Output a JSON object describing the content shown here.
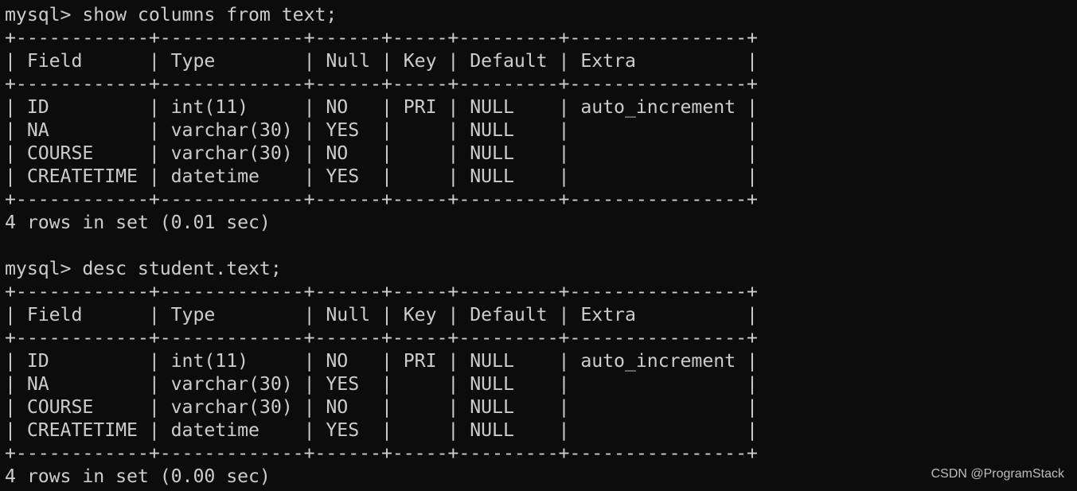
{
  "terminal": {
    "prompt": "mysql> ",
    "blocks": [
      {
        "command": "show columns from text;",
        "columns": [
          "Field",
          "Type",
          "Null",
          "Key",
          "Default",
          "Extra"
        ],
        "rows": [
          [
            "ID",
            "int(11)",
            "NO",
            "PRI",
            "NULL",
            "auto_increment"
          ],
          [
            "NA",
            "varchar(30)",
            "YES",
            "",
            "NULL",
            ""
          ],
          [
            "COURSE",
            "varchar(30)",
            "NO",
            "",
            "NULL",
            ""
          ],
          [
            "CREATETIME",
            "datetime",
            "YES",
            "",
            "NULL",
            ""
          ]
        ],
        "footer": "4 rows in set (0.01 sec)"
      },
      {
        "command": "desc student.text;",
        "columns": [
          "Field",
          "Type",
          "Null",
          "Key",
          "Default",
          "Extra"
        ],
        "rows": [
          [
            "ID",
            "int(11)",
            "NO",
            "PRI",
            "NULL",
            "auto_increment"
          ],
          [
            "NA",
            "varchar(30)",
            "YES",
            "",
            "NULL",
            ""
          ],
          [
            "COURSE",
            "varchar(30)",
            "NO",
            "",
            "NULL",
            ""
          ],
          [
            "CREATETIME",
            "datetime",
            "YES",
            "",
            "NULL",
            ""
          ]
        ],
        "footer": "4 rows in set (0.00 sec)"
      }
    ]
  },
  "watermark": "CSDN @ProgramStack"
}
